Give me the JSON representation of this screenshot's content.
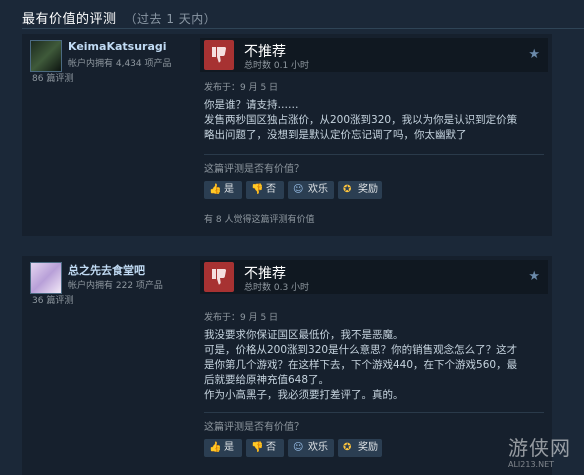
{
  "header": {
    "title": "最有价值的评测",
    "subtitle": "（过去 1 天内）"
  },
  "reviews": [
    {
      "author": {
        "name": "KeimaKatsuragi",
        "games": "帐户内拥有 4,434 项产品",
        "reviews": "86 篇评测"
      },
      "verdict": "不推荐",
      "hours": "总时数 0.1 小时",
      "posted": "发布于：9 月 5 日",
      "lines": [
        "你是谁？请支持……",
        "发售两秒国区独占涨价，从200涨到320，我以为你是认识到定价策",
        "略出问题了，没想到是默认定价忘记调了吗，你太幽默了"
      ],
      "helpful_question": "这篇评测是否有价值？",
      "buttons": {
        "yes": "是",
        "no": "否",
        "funny": "欢乐",
        "award": "奖励"
      },
      "helpful_count": "有 8 人觉得这篇评测有价值"
    },
    {
      "author": {
        "name": "总之先去食堂吧",
        "games": "帐户内拥有 222 项产品",
        "reviews": "36 篇评测"
      },
      "verdict": "不推荐",
      "hours": "总时数 0.3 小时",
      "posted": "发布于：9 月 5 日",
      "lines": [
        "我没要求你保证国区最低价，我不是恶魔。",
        "可是，价格从200涨到320是什么意思？你的销售观念怎么了？这才",
        "是你第几个游戏？在这样下去，下个游戏440，在下个游戏560，最",
        "后就要给原神充值648了。",
        "作为小高黑子，我必须要打差评了。真的。"
      ],
      "helpful_question": "这篇评测是否有价值？",
      "buttons": {
        "yes": "是",
        "no": "否",
        "funny": "欢乐",
        "award": "奖励"
      }
    }
  ],
  "watermark": {
    "text": "游侠网",
    "url": "ALI213.NET"
  },
  "colors": {
    "background": "#1b2838",
    "panel": "#16202d",
    "thumb_down": "#a73232",
    "button": "#2b3e52",
    "award": "#ffc53d"
  },
  "icons": [
    "thumbs-down-icon",
    "star-icon",
    "thumbs-up-icon",
    "smile-icon",
    "award-icon"
  ]
}
